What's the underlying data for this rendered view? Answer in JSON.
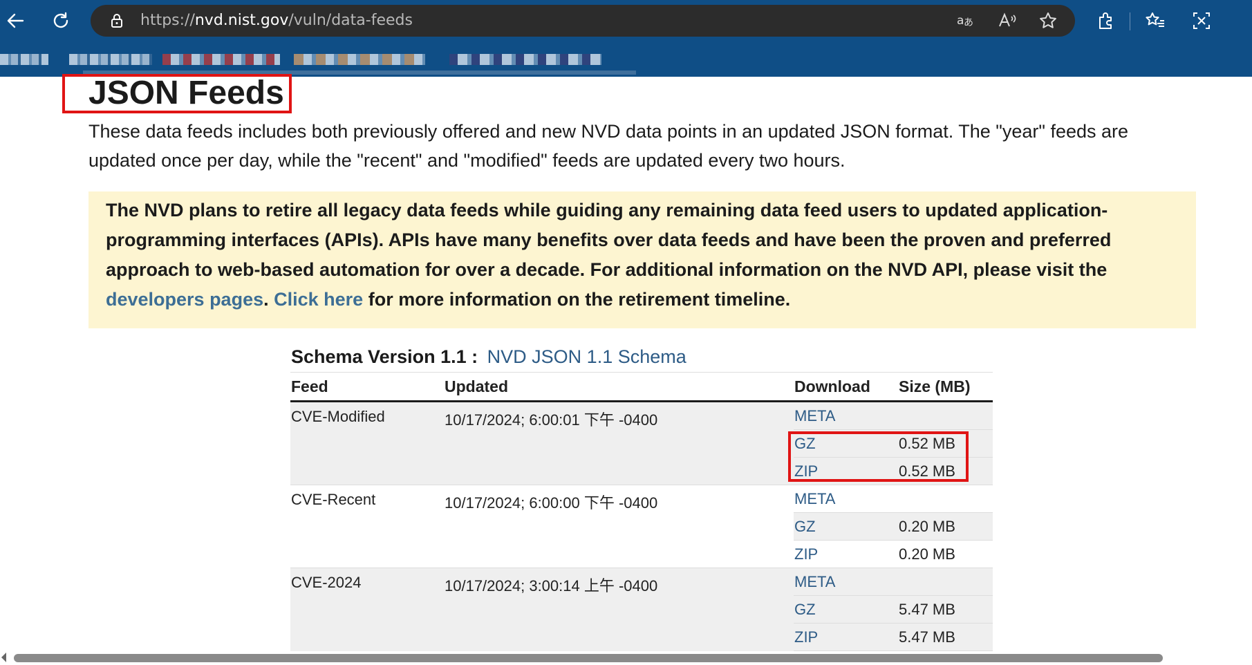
{
  "browser": {
    "url_prefix": "https://",
    "url_host": "nvd.nist.gov",
    "url_path": "/vuln/data-feeds",
    "icons": [
      "back-icon",
      "refresh-icon",
      "lock-icon",
      "translate-icon",
      "read-aloud-icon",
      "favorite-star-icon",
      "extensions-icon",
      "favorites-icon",
      "screenshot-icon"
    ]
  },
  "page": {
    "title": "JSON Feeds",
    "intro": "These data feeds includes both previously offered and new NVD data points in an updated JSON format. The \"year\" feeds are updated once per day, while the \"recent\" and \"modified\" feeds are updated every two hours.",
    "notice": {
      "text_before": "The NVD plans to retire all legacy data feeds while guiding any remaining data feed users to updated application-programming interfaces (APIs). APIs have many benefits over data feeds and have been the proven and preferred approach to web-based automation for over a decade. For additional information on the NVD API, please visit the ",
      "link1": "developers pages",
      "text_middle": ". ",
      "link2": "Click here",
      "text_after": " for more information on the retirement timeline."
    },
    "schema": {
      "label": "Schema Version 1.1 :",
      "link": "NVD JSON 1.1 Schema"
    },
    "table": {
      "headers": {
        "feed": "Feed",
        "updated": "Updated",
        "download": "Download",
        "size": "Size (MB)"
      },
      "groups": [
        {
          "feed": "CVE-Modified",
          "updated": "10/17/2024; 6:00:01 下午 -0400",
          "rows": [
            {
              "dl": "META",
              "size": ""
            },
            {
              "dl": "GZ",
              "size": "0.52 MB"
            },
            {
              "dl": "ZIP",
              "size": "0.52 MB"
            }
          ]
        },
        {
          "feed": "CVE-Recent",
          "updated": "10/17/2024; 6:00:00 下午 -0400",
          "rows": [
            {
              "dl": "META",
              "size": ""
            },
            {
              "dl": "GZ",
              "size": "0.20 MB"
            },
            {
              "dl": "ZIP",
              "size": "0.20 MB"
            }
          ]
        },
        {
          "feed": "CVE-2024",
          "updated": "10/17/2024; 3:00:14 上午 -0400",
          "rows": [
            {
              "dl": "META",
              "size": ""
            },
            {
              "dl": "GZ",
              "size": "5.47 MB"
            },
            {
              "dl": "ZIP",
              "size": "5.47 MB"
            }
          ]
        }
      ]
    }
  },
  "colors": {
    "chrome": "#0f4e86",
    "notice_bg": "#fdf5d1",
    "link": "#2d5b86",
    "highlight": "#e01414"
  }
}
